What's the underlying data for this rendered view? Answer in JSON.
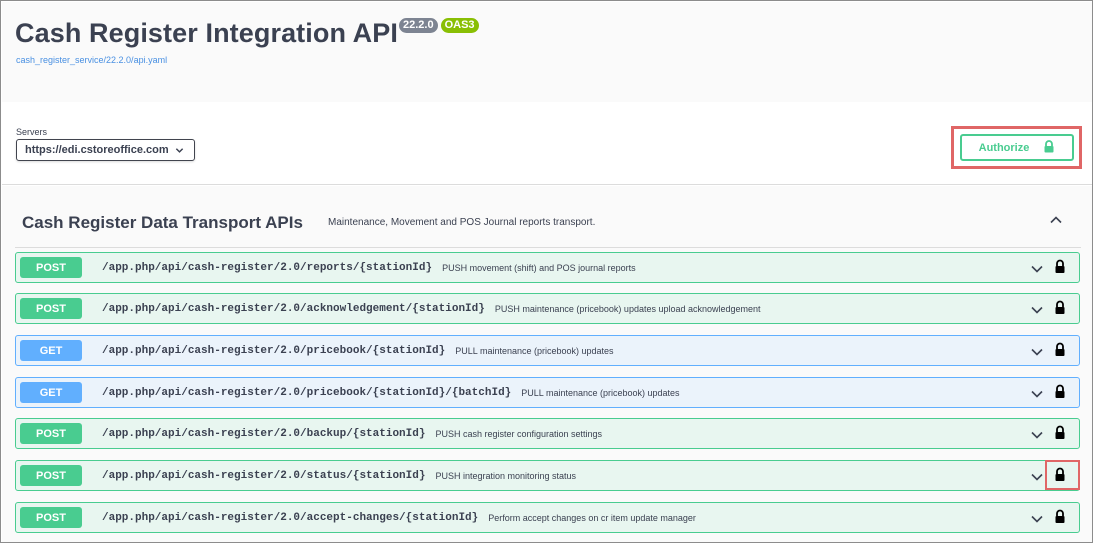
{
  "info": {
    "title": "Cash Register Integration API",
    "version_badge": "22.2.0",
    "oas_badge": "OAS3",
    "spec_link": "cash_register_service/22.2.0/api.yaml"
  },
  "servers": {
    "label": "Servers",
    "selected": "https://edi.cstoreoffice.com"
  },
  "authorize": {
    "label": "Authorize"
  },
  "tag": {
    "title": "Cash Register Data Transport APIs",
    "description": "Maintenance, Movement and POS Journal reports transport."
  },
  "operations": [
    {
      "method": "POST",
      "path": "/app.php/api/cash-register/2.0/reports/{stationId}",
      "summary": "PUSH movement (shift) and POS journal reports"
    },
    {
      "method": "POST",
      "path": "/app.php/api/cash-register/2.0/acknowledgement/{stationId}",
      "summary": "PUSH maintenance (pricebook) updates upload acknowledgement"
    },
    {
      "method": "GET",
      "path": "/app.php/api/cash-register/2.0/pricebook/{stationId}",
      "summary": "PULL maintenance (pricebook) updates"
    },
    {
      "method": "GET",
      "path": "/app.php/api/cash-register/2.0/pricebook/{stationId}/{batchId}",
      "summary": "PULL maintenance (pricebook) updates"
    },
    {
      "method": "POST",
      "path": "/app.php/api/cash-register/2.0/backup/{stationId}",
      "summary": "PUSH cash register configuration settings"
    },
    {
      "method": "POST",
      "path": "/app.php/api/cash-register/2.0/status/{stationId}",
      "summary": "PUSH integration monitoring status"
    },
    {
      "method": "POST",
      "path": "/app.php/api/cash-register/2.0/accept-changes/{stationId}",
      "summary": "Perform accept changes on cr item update manager"
    }
  ],
  "colors": {
    "post": "#49cc90",
    "get": "#61affe",
    "highlight": "#e06666"
  }
}
